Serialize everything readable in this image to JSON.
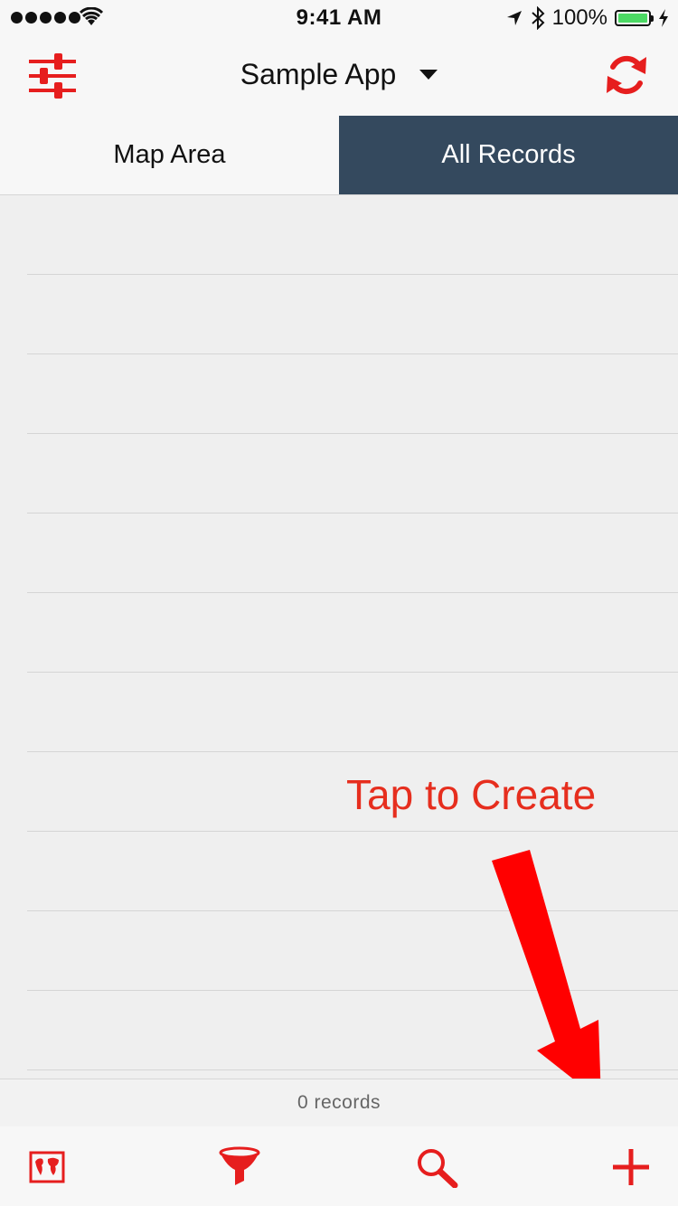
{
  "status_bar": {
    "time": "9:41 AM",
    "battery_percent": "100%",
    "signal_bars": 5,
    "icons": [
      "signal-dots-icon",
      "wifi-icon",
      "location-arrow-icon",
      "bluetooth-icon",
      "battery-icon",
      "charging-bolt-icon"
    ]
  },
  "nav": {
    "title": "Sample App",
    "left_icon": "filters-sliders-icon",
    "right_icon": "sync-icon",
    "accent_color": "#e61e1e"
  },
  "tabs": [
    {
      "label": "Map Area",
      "selected": false
    },
    {
      "label": "All Records",
      "selected": true,
      "selected_color": "#34495e"
    }
  ],
  "list": {
    "rows": 11,
    "items": []
  },
  "annotation": {
    "text": "Tap to Create",
    "color": "#e62e1e"
  },
  "footer": {
    "count_text": "0 records"
  },
  "toolbar": {
    "items": [
      {
        "icon": "map-icon"
      },
      {
        "icon": "filter-funnel-icon"
      },
      {
        "icon": "search-icon"
      },
      {
        "icon": "add-icon"
      }
    ]
  }
}
